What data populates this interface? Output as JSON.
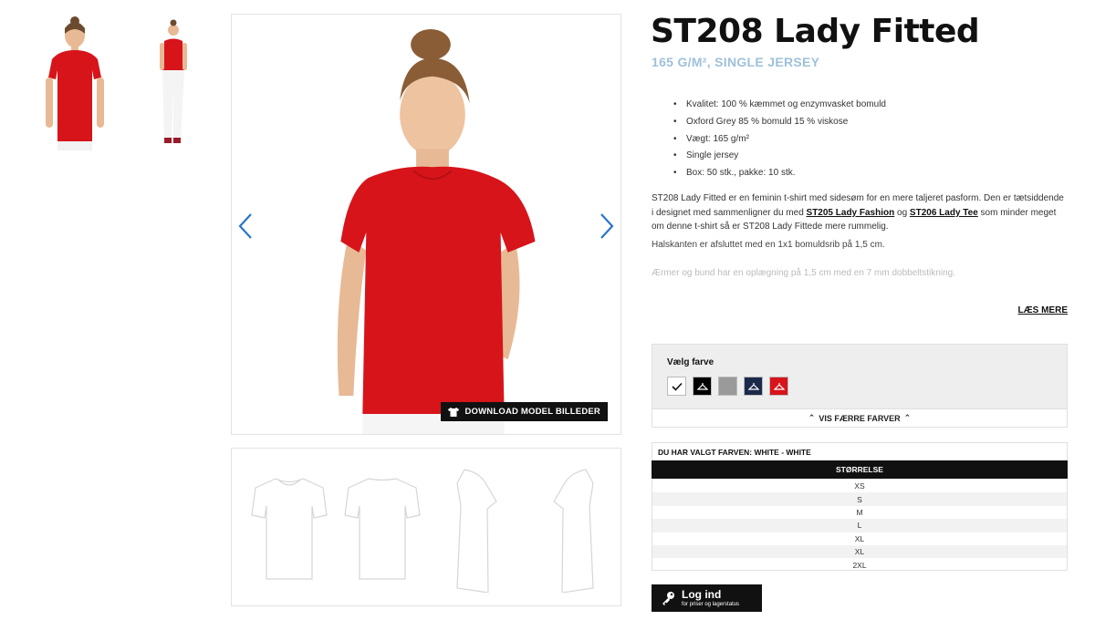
{
  "thumbnails": [
    {
      "name": "front-view",
      "shirt_color": "#d7141a"
    },
    {
      "name": "full-body-view",
      "shirt_color": "#d7141a"
    }
  ],
  "main_image": {
    "shirt_color": "#d7141a",
    "download_label": "DOWNLOAD MODEL BILLEDER",
    "prev_icon": "chevron-left-icon",
    "next_icon": "chevron-right-icon"
  },
  "flat_images": [
    "front",
    "back",
    "side-left",
    "side-right"
  ],
  "product": {
    "title": "ST208 Lady Fitted",
    "subtitle": "165 G/M², SINGLE JERSEY",
    "specs": [
      "Kvalitet: 100 % kæmmet og enzymvasket bomuld",
      "Oxford Grey 85 % bomuld 15 % viskose",
      "Vægt: 165 g/m²",
      "Single jersey",
      "Box: 50 stk., pakke: 10 stk."
    ],
    "description": {
      "part1": "ST208 Lady Fitted er en feminin t-shirt med sidesøm for en mere taljeret pasform. Den er tætsiddende i designet med sammenligner du med ",
      "link1": "ST205 Lady Fashion",
      "part2": " og ",
      "link2": "ST206 Lady Tee",
      "part3": " som minder meget om denne t-shirt så er ST208 Lady Fittede mere rummelig."
    },
    "description2": "Halskanten er afsluttet med en 1x1 bomuldsrib på 1,5 cm.",
    "description3": "Ærmer og bund har en oplægning på 1,5 cm med en 7 mm dobbeltstikning.",
    "read_more": "LÆS MERE"
  },
  "colors": {
    "label": "Vælg farve",
    "swatches": [
      {
        "name": "white",
        "hex": "#ffffff",
        "selected": true
      },
      {
        "name": "black",
        "hex": "#000000"
      },
      {
        "name": "grey",
        "hex": "#9a9a9a"
      },
      {
        "name": "navy",
        "hex": "#1b2a4a"
      },
      {
        "name": "red",
        "hex": "#d7141a"
      }
    ],
    "fewer_label": "VIS FÆRRE FARVER"
  },
  "sizes": {
    "chosen_label": "DU HAR VALGT FARVEN: WHITE - WHITE",
    "header": "STØRRELSE",
    "items": [
      "XS",
      "S",
      "M",
      "L",
      "XL",
      "XL",
      "2XL"
    ]
  },
  "login": {
    "label": "Log ind",
    "sublabel": "for priser og lagerstatus",
    "icon": "key-icon"
  }
}
